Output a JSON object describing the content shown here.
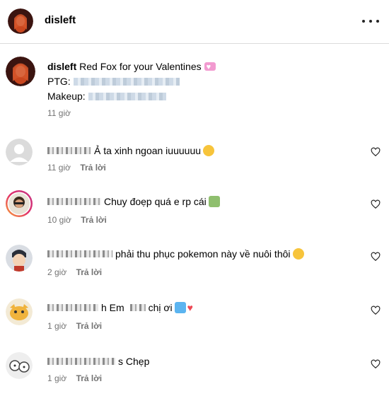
{
  "header": {
    "username": "disleft"
  },
  "caption": {
    "username": "disleft",
    "title": "Red Fox for your Valentines",
    "ptg_label": "PTG:",
    "makeup_label": "Makeup:",
    "time": "11 giờ"
  },
  "comments": [
    {
      "text": "Ả ta xinh ngoan iuuuuuu",
      "time": "11 giờ",
      "reply": "Trả lời"
    },
    {
      "text": "Chuy đoẹp quá e rp cái",
      "time": "10 giờ",
      "reply": "Trả lời"
    },
    {
      "text": "phải thu phục pokemon này về nuôi thôi",
      "time": "2 giờ",
      "reply": "Trả lời"
    },
    {
      "text_before": "h Em",
      "text_after": "chị ơi",
      "time": "1 giờ",
      "reply": "Trả lời"
    },
    {
      "text": "s Chẹp",
      "time": "1 giờ",
      "reply": "Trả lời"
    }
  ],
  "colors": {
    "meta_gray": "#737373",
    "divider": "#dbdbdb",
    "heart_red": "#ed4956"
  }
}
